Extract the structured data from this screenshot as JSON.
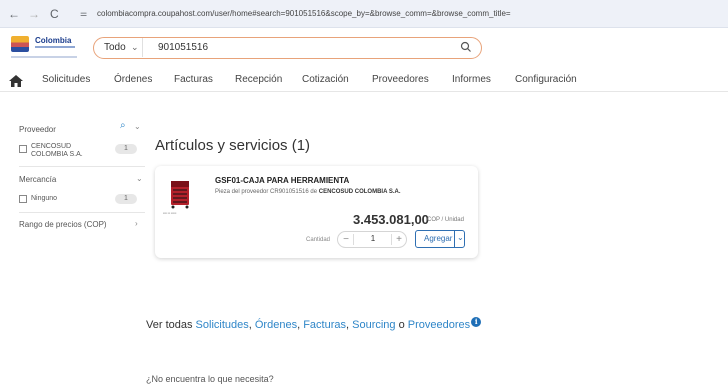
{
  "browser": {
    "back": "←",
    "forward": "→",
    "reload": "C",
    "url": "colombiacompra.coupahost.com/user/home#search=901051516&scope_by=&browse_comm=&browse_comm_title="
  },
  "header": {
    "logo_text": "Colombia",
    "search": {
      "scope": "Todo",
      "value": "901051516"
    }
  },
  "nav": {
    "items": [
      "Solicitudes",
      "Órdenes",
      "Facturas",
      "Recepción",
      "Cotización",
      "Proveedores",
      "Informes",
      "Configuración"
    ]
  },
  "filters": {
    "supplier": {
      "title": "Proveedor",
      "option": "CENCOSUD COLOMBIA S.A.",
      "count": "1"
    },
    "commodity": {
      "title": "Mercancía",
      "option": "Ninguno",
      "count": "1"
    },
    "price": {
      "title": "Rango de precios (COP)"
    }
  },
  "results": {
    "title": "Artículos y servicios (1)",
    "item": {
      "name": "GSF01-CAJA PARA HERRAMIENTA",
      "supplier_prefix": "Pieza del proveedor CR901051516 de",
      "supplier_name": "CENCOSUD COLOMBIA S.A.",
      "price": "3.453.081,00",
      "unit": "COP / Unidad",
      "qty_label": "Cantidad",
      "qty": "1",
      "add_label": "Agregar"
    }
  },
  "footer": {
    "view_all_prefix": "Ver todas",
    "links": [
      "Solicitudes",
      "Órdenes",
      "Facturas",
      "Sourcing",
      "Proveedores"
    ],
    "or": "o",
    "not_found": "¿No encuentra lo que necesita?"
  },
  "colors": {
    "accent": "#2f6fb2",
    "link": "#2f86c8",
    "search_border": "#e8a37a"
  }
}
